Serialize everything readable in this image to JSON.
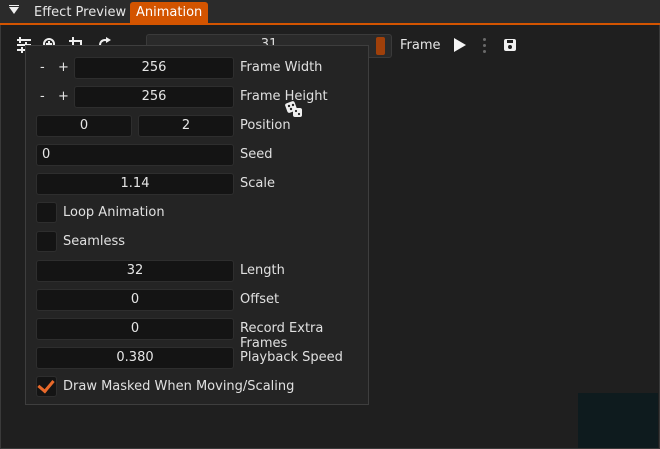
{
  "tabs": [
    {
      "label": "Effect Preview"
    },
    {
      "label": "Animation"
    }
  ],
  "toolbar": {
    "frame_value": "31",
    "frame_label": "Frame"
  },
  "popup": {
    "frame_width": {
      "minus": "-",
      "plus": "+",
      "value": "256",
      "label": "Frame Width"
    },
    "frame_height": {
      "minus": "-",
      "plus": "+",
      "value": "256",
      "label": "Frame Height"
    },
    "position": {
      "x": "0",
      "y": "2",
      "label": "Position"
    },
    "seed": {
      "value": "0",
      "label": "Seed"
    },
    "scale": {
      "value": "1.14",
      "label": "Scale"
    },
    "loop_animation": {
      "label": "Loop Animation",
      "checked": false
    },
    "seamless": {
      "label": "Seamless",
      "checked": false
    },
    "length": {
      "value": "32",
      "label": "Length"
    },
    "offset": {
      "value": "0",
      "label": "Offset"
    },
    "record_extra_frames": {
      "value": "0",
      "label": "Record Extra Frames"
    },
    "playback_speed": {
      "value": "0.380",
      "label": "Playback Speed"
    },
    "draw_masked": {
      "label": "Draw Masked When Moving/Scaling",
      "checked": true
    }
  },
  "colors": {
    "accent": "#d35400",
    "check": "#e8692a"
  }
}
